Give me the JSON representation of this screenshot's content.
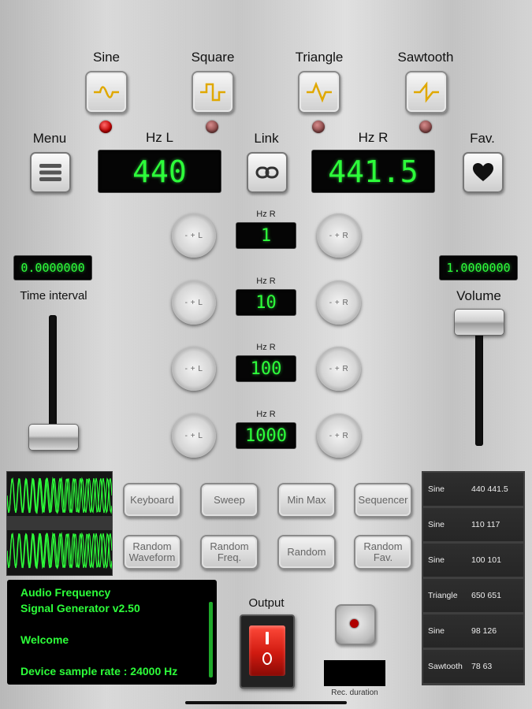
{
  "waveforms": [
    {
      "label": "Sine",
      "icon": "sine-wave-icon",
      "active": true
    },
    {
      "label": "Square",
      "icon": "square-wave-icon",
      "active": false
    },
    {
      "label": "Triangle",
      "icon": "triangle-wave-icon",
      "active": false
    },
    {
      "label": "Sawtooth",
      "icon": "sawtooth-wave-icon",
      "active": false
    }
  ],
  "menu_label": "Menu",
  "hz_left": {
    "label": "Hz L",
    "value": "440"
  },
  "link_label": "Link",
  "hz_right": {
    "label": "Hz R",
    "value": "441.5"
  },
  "fav_label": "Fav.",
  "steps": [
    {
      "label": "Hz R",
      "value": "1",
      "knob_left": "- + L",
      "knob_right": "- + R"
    },
    {
      "label": "Hz R",
      "value": "10",
      "knob_left": "- + L",
      "knob_right": "- + R"
    },
    {
      "label": "Hz R",
      "value": "100",
      "knob_left": "- + L",
      "knob_right": "- + R"
    },
    {
      "label": "Hz R",
      "value": "1000",
      "knob_left": "- + L",
      "knob_right": "- + R"
    }
  ],
  "time_interval": {
    "label": "Time interval",
    "value": "0.0000000",
    "level": 0.0
  },
  "volume": {
    "label": "Volume",
    "value": "1.0000000",
    "level": 1.0
  },
  "buttons_row1": [
    "Keyboard",
    "Sweep",
    "Min Max",
    "Sequencer"
  ],
  "buttons_row2": [
    "Random\nWaveform",
    "Random\nFreq.",
    "Random",
    "Random\nFav."
  ],
  "favorites": [
    {
      "type": "Sine",
      "freqs": "440 441.5"
    },
    {
      "type": "Sine",
      "freqs": "110 117"
    },
    {
      "type": "Sine",
      "freqs": "100 101"
    },
    {
      "type": "Triangle",
      "freqs": "650 651"
    },
    {
      "type": "Sine",
      "freqs": "98 126"
    },
    {
      "type": "Sawtooth",
      "freqs": "78 63"
    }
  ],
  "console": {
    "line1": "Audio Frequency",
    "line2": "Signal Generator v2.50",
    "line3": "Welcome",
    "line4": "Device sample rate : 24000 Hz"
  },
  "output_label": "Output",
  "rec_label": "Rec. duration",
  "rec_value": "",
  "colors": {
    "lcd_green": "#2dff3a",
    "led_red": "#c00000",
    "wave_yellow": "#e0a800"
  }
}
